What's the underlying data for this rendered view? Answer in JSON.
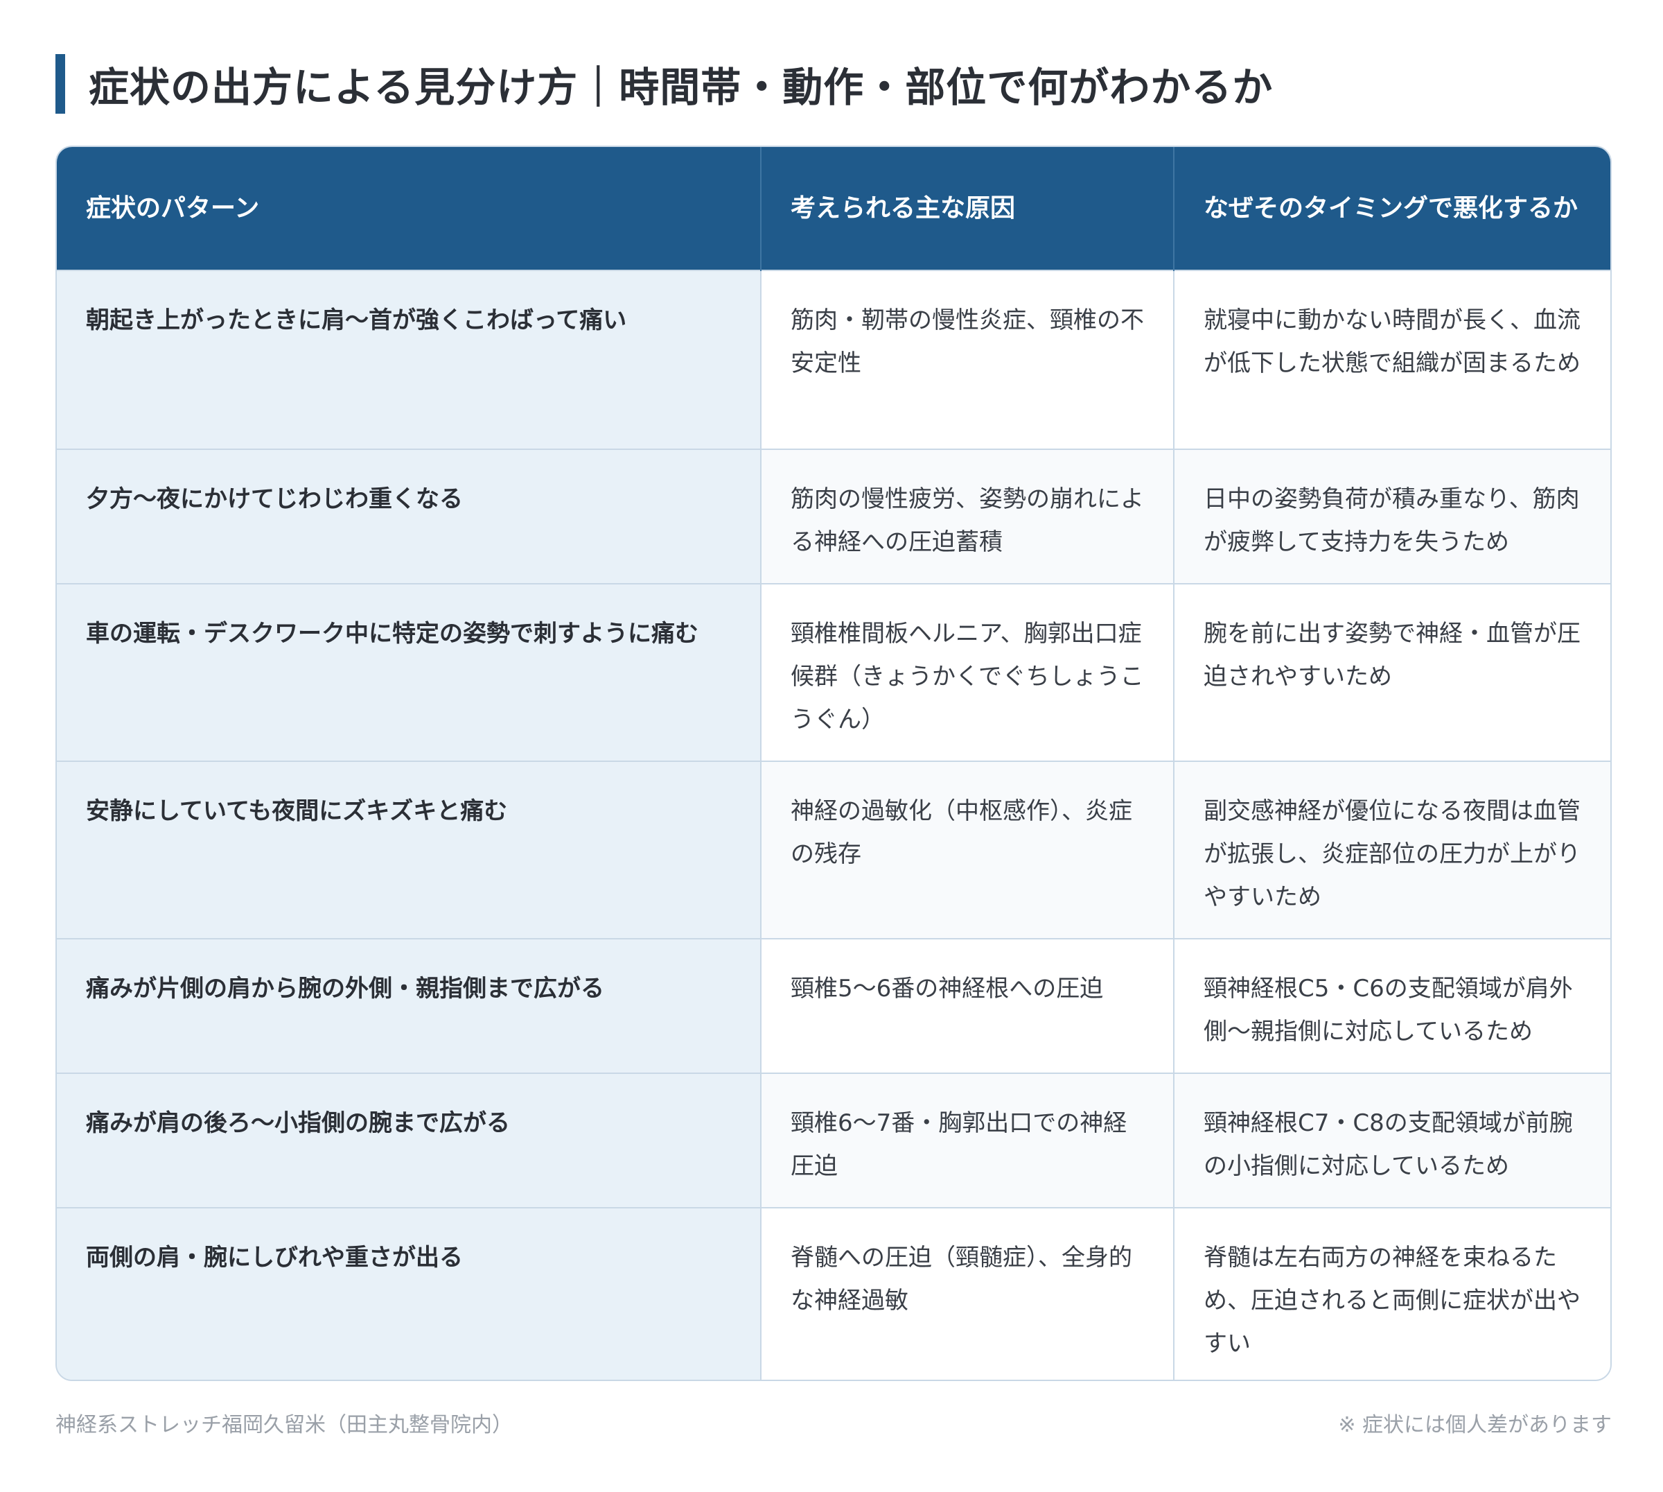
{
  "title": "症状の出方による見分け方｜時間帯・動作・部位で何がわかるか",
  "table": {
    "headers": [
      "症状のパターン",
      "考えられる主な原因",
      "なぜそのタイミングで悪化するか"
    ],
    "rows": [
      {
        "pattern": "朝起き上がったときに肩〜首が強くこわばって痛い",
        "cause": "筋肉・靭帯の慢性炎症、頸椎の不安定性",
        "reason": "就寝中に動かない時間が長く、血流が低下した状態で組織が固まるため"
      },
      {
        "pattern": "夕方〜夜にかけてじわじわ重くなる",
        "cause": "筋肉の慢性疲労、姿勢の崩れによる神経への圧迫蓄積",
        "reason": "日中の姿勢負荷が積み重なり、筋肉が疲弊して支持力を失うため"
      },
      {
        "pattern": "車の運転・デスクワーク中に特定の姿勢で刺すように痛む",
        "cause": "頸椎椎間板ヘルニア、胸郭出口症候群（きょうかくでぐちしょうこうぐん）",
        "reason": "腕を前に出す姿勢で神経・血管が圧迫されやすいため"
      },
      {
        "pattern": "安静にしていても夜間にズキズキと痛む",
        "cause": "神経の過敏化（中枢感作）、炎症の残存",
        "reason": "副交感神経が優位になる夜間は血管が拡張し、炎症部位の圧力が上がりやすいため"
      },
      {
        "pattern": "痛みが片側の肩から腕の外側・親指側まで広がる",
        "cause": "頸椎5〜6番の神経根への圧迫",
        "reason": "頸神経根C5・C6の支配領域が肩外側〜親指側に対応しているため"
      },
      {
        "pattern": "痛みが肩の後ろ〜小指側の腕まで広がる",
        "cause": "頸椎6〜7番・胸郭出口での神経圧迫",
        "reason": "頸神経根C7・C8の支配領域が前腕の小指側に対応しているため"
      },
      {
        "pattern": "両側の肩・腕にしびれや重さが出る",
        "cause": "脊髄への圧迫（頸髄症）、全身的な神経過敏",
        "reason": "脊髄は左右両方の神経を束ねるため、圧迫されると両側に症状が出やすい"
      }
    ]
  },
  "footer": {
    "source": "神経系ストレッチ福岡久留米（田主丸整骨院内）",
    "note": "※ 症状には個人差があります"
  },
  "colors": {
    "accent": "#1f5a8b",
    "pattern_cell_bg": "#e8f1f8",
    "border": "#c9d8e6"
  }
}
